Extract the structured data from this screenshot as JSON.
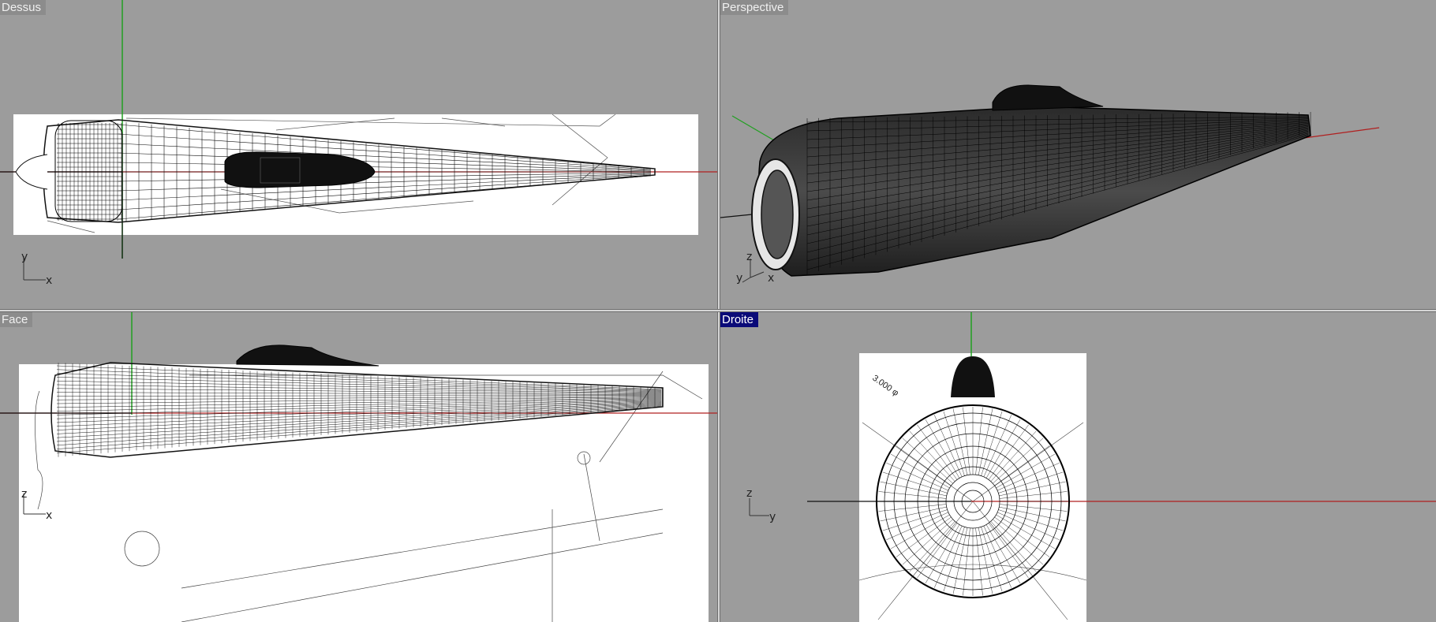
{
  "viewports": {
    "top": {
      "title": "Dessus",
      "axis_v": "y",
      "axis_h": "x",
      "active": false
    },
    "perspective": {
      "title": "Perspective",
      "axis_a": "z",
      "axis_b": "y",
      "axis_c": "x",
      "active": false
    },
    "front": {
      "title": "Face",
      "axis_v": "z",
      "axis_h": "x",
      "active": false
    },
    "right": {
      "title": "Droite",
      "axis_v": "z",
      "axis_h": "y",
      "active": true,
      "blueprint_note": "3.000 φ"
    }
  },
  "colors": {
    "viewport_bg": "#9c9c9c",
    "active_title_bg": "#0a0a78",
    "x_axis": "#b02020",
    "y_axis": "#22a022",
    "wire": "#111111",
    "blueprint": "#ffffff"
  }
}
